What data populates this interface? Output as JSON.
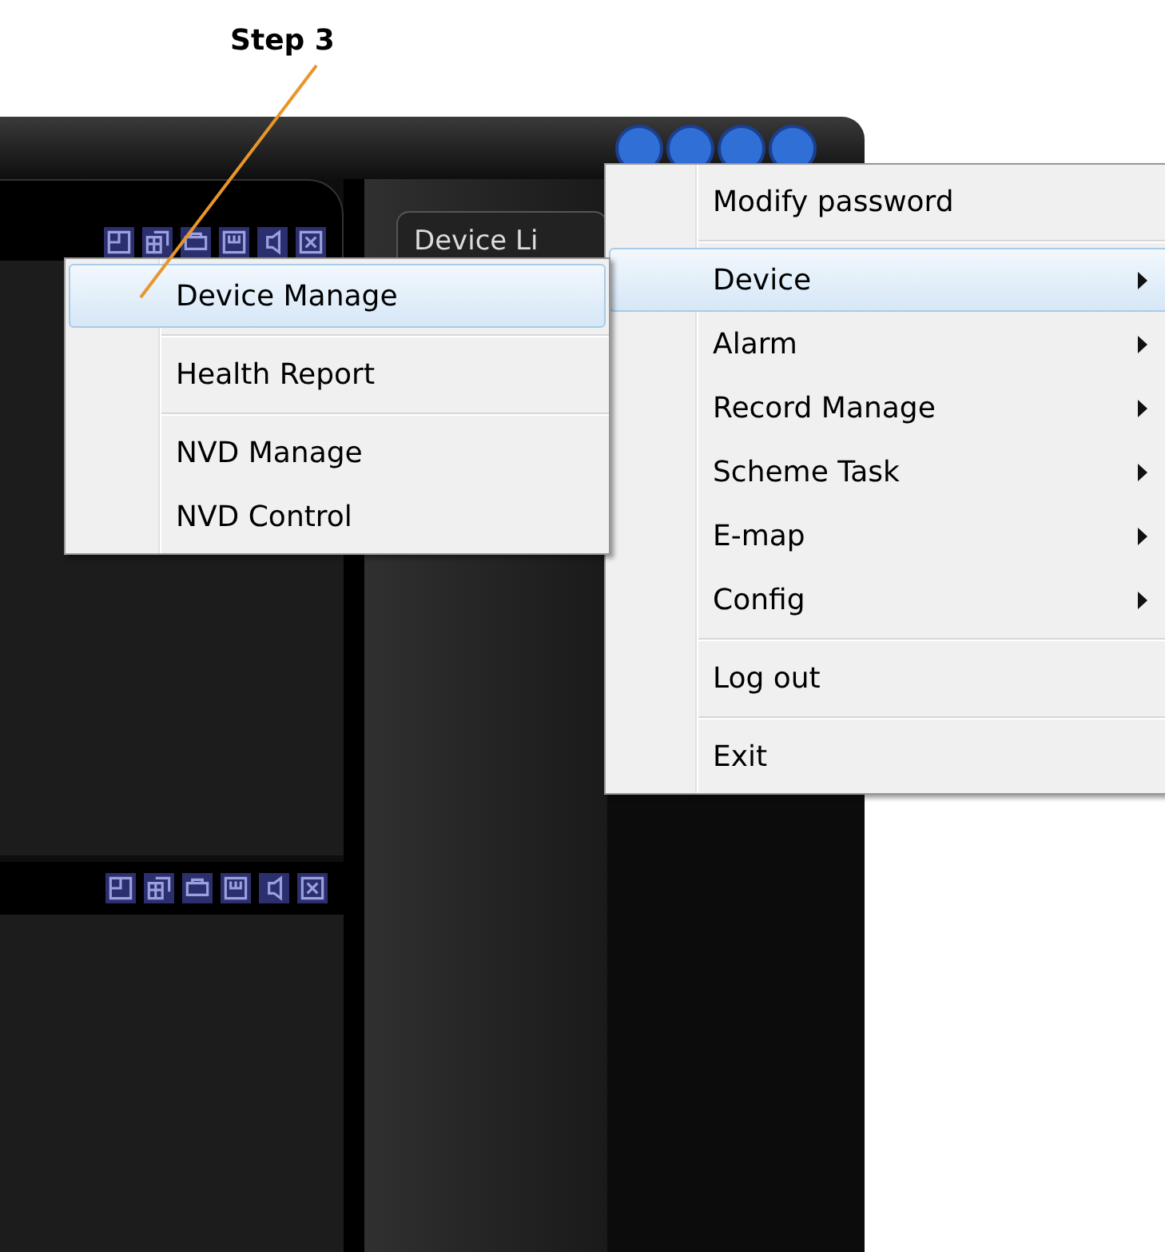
{
  "annotation": {
    "label": "Step 3"
  },
  "app": {
    "device_tab": "Device Li"
  },
  "menu": {
    "items": [
      {
        "kind": "item",
        "label": "Modify password",
        "has_submenu": false,
        "selected": false
      },
      {
        "kind": "separator"
      },
      {
        "kind": "item",
        "label": "Device",
        "has_submenu": true,
        "selected": true
      },
      {
        "kind": "item",
        "label": "Alarm",
        "has_submenu": true,
        "selected": false
      },
      {
        "kind": "item",
        "label": "Record Manage",
        "has_submenu": true,
        "selected": false
      },
      {
        "kind": "item",
        "label": "Scheme Task",
        "has_submenu": true,
        "selected": false
      },
      {
        "kind": "item",
        "label": "E-map",
        "has_submenu": true,
        "selected": false
      },
      {
        "kind": "item",
        "label": "Config",
        "has_submenu": true,
        "selected": false
      },
      {
        "kind": "separator"
      },
      {
        "kind": "item",
        "label": "Log out",
        "has_submenu": false,
        "selected": false
      },
      {
        "kind": "separator"
      },
      {
        "kind": "item",
        "label": "Exit",
        "has_submenu": false,
        "selected": false
      }
    ]
  },
  "submenu": {
    "items": [
      {
        "kind": "item",
        "label": "Device Manage",
        "has_submenu": false,
        "selected": true
      },
      {
        "kind": "separator"
      },
      {
        "kind": "item",
        "label": "Health Report",
        "has_submenu": false,
        "selected": false
      },
      {
        "kind": "separator"
      },
      {
        "kind": "item",
        "label": "NVD Manage",
        "has_submenu": false,
        "selected": false
      },
      {
        "kind": "item",
        "label": "NVD Control",
        "has_submenu": false,
        "selected": false
      }
    ]
  }
}
